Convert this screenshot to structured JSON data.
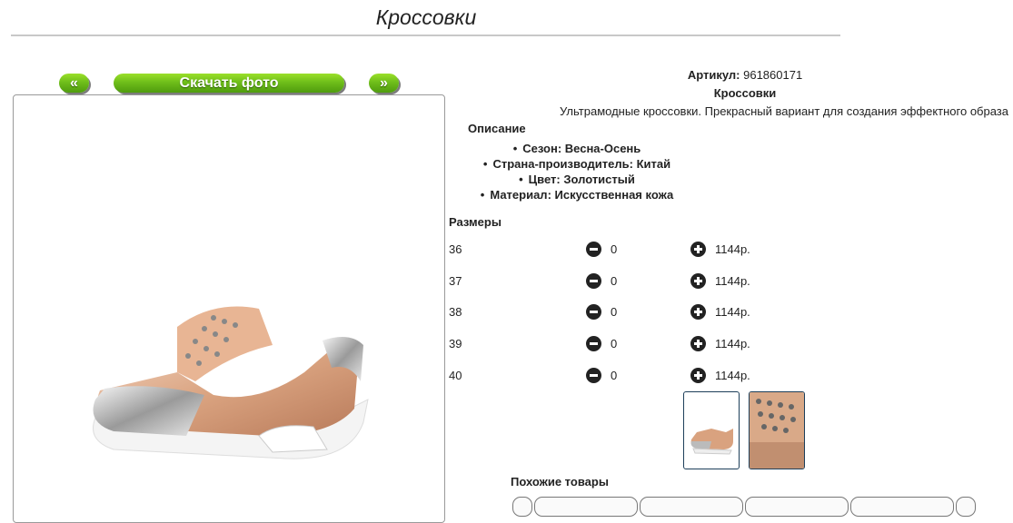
{
  "page": {
    "title": "Кроссовки"
  },
  "gallery": {
    "prev_label": "«",
    "download_label": "Скачать фото",
    "next_label": "»"
  },
  "product": {
    "article_label": "Артикул:",
    "article_value": "961860171",
    "name": "Кроссовки",
    "description": "Ультрамодные кроссовки. Прекрасный вариант для создания эффектного образа",
    "description_heading": "Описание",
    "properties": [
      "Сезон: Весна-Осень",
      "Страна-производитель: Китай",
      "Цвет: Золотистый",
      "Материал: Искусственная кожа"
    ]
  },
  "sizes": {
    "heading": "Размеры",
    "rows": [
      {
        "size": "36",
        "qty": "0",
        "price": "1144р."
      },
      {
        "size": "37",
        "qty": "0",
        "price": "1144р."
      },
      {
        "size": "38",
        "qty": "0",
        "price": "1144р."
      },
      {
        "size": "39",
        "qty": "0",
        "price": "1144р."
      },
      {
        "size": "40",
        "qty": "0",
        "price": "1144р."
      }
    ]
  },
  "similar": {
    "heading": "Похожие товары"
  },
  "icons": {
    "minus": "minus-circle-icon",
    "plus": "plus-circle-icon"
  },
  "colors": {
    "button_green": "#6fbe1a",
    "thumb_border": "#1d3f5a",
    "rule": "#c8c8c8"
  }
}
